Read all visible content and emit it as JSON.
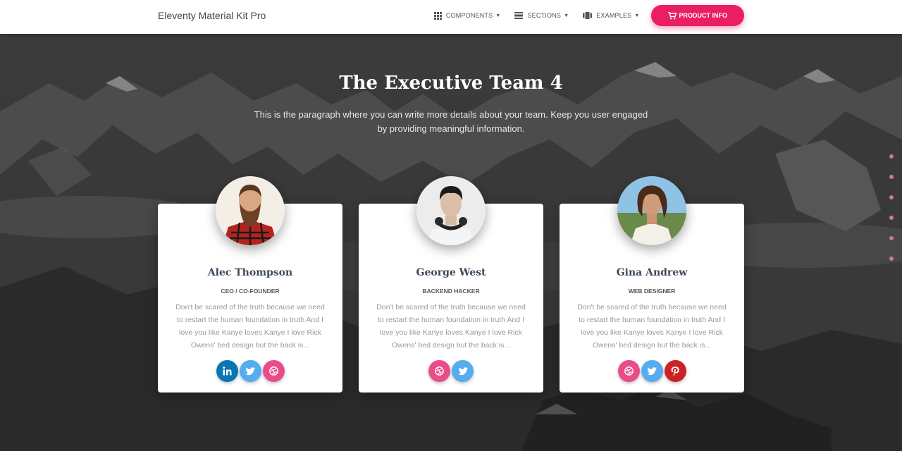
{
  "navbar": {
    "brand": "Eleventy Material Kit Pro",
    "items": [
      {
        "label": "COMPONENTS",
        "icon": "apps-icon"
      },
      {
        "label": "SECTIONS",
        "icon": "view-day-icon"
      },
      {
        "label": "EXAMPLES",
        "icon": "view-carousel-icon"
      }
    ],
    "cta": {
      "label": "PRODUCT INFO",
      "icon": "shopping-cart-icon"
    }
  },
  "section": {
    "title": "The Executive Team 4",
    "description": "This is the paragraph where you can write more details about your team. Keep you user engaged by providing meaningful information."
  },
  "team": [
    {
      "name": "Alec Thompson",
      "role": "CEO / CO-FOUNDER",
      "bio": "Don't be scared of the truth because we need to restart the human foundation in truth And I love you like Kanye loves Kanye I love Rick Owens' bed design but the back is...",
      "socials": [
        "linkedin",
        "twitter",
        "dribbble"
      ]
    },
    {
      "name": "George West",
      "role": "BACKEND HACKER",
      "bio": "Don't be scared of the truth because we need to restart the human foundation in truth And I love you like Kanye loves Kanye I love Rick Owens' bed design but the back is...",
      "socials": [
        "dribbble",
        "twitter"
      ]
    },
    {
      "name": "Gina Andrew",
      "role": "WEB DESIGNER",
      "bio": "Don't be scared of the truth because we need to restart the human foundation in truth And I love you like Kanye loves Kanye I love Rick Owens' bed design but the back is...",
      "socials": [
        "dribbble",
        "twitter",
        "pinterest"
      ]
    }
  ],
  "colors": {
    "primary": "#e91e63",
    "linkedin": "#0976b4",
    "twitter": "#55acee",
    "dribbble": "#ea4c89",
    "pinterest": "#cc2127",
    "dots": "#d0779a"
  },
  "side_nav_dots": 6
}
